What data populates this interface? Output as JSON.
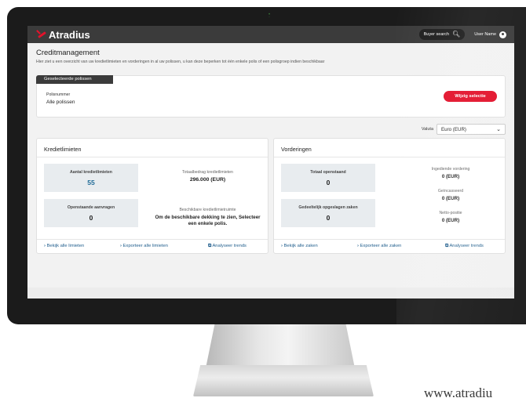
{
  "app": {
    "brand": "Atradius"
  },
  "header": {
    "buyer_search": "Buyer search",
    "user_name": "User Name"
  },
  "page": {
    "title": "Creditmanagement",
    "description": "Hier ziet u een overzicht van uw kredietlimieten en vorderingen in al uw polissen, u kan deze beperken tot één enkele polis of een polisgroep indien beschikbaar"
  },
  "selection": {
    "tab": "Geselecteerde polissen",
    "label": "Polisnummer",
    "value": "Alle polissen",
    "button": "Wijzig selectie"
  },
  "valuta": {
    "label": "Valuta",
    "selected": "Euro (EUR)"
  },
  "kredietlimieten": {
    "title": "Kredietlimieten",
    "tile1_label": "Aantal kredietlimieten",
    "tile1_value": "55",
    "tile2_label": "Openstaande aanvragen",
    "tile2_value": "0",
    "stat1_label": "Totaalbedrag kredietlimieten",
    "stat1_value": "296.000 (EUR)",
    "stat2_label": "Beschikbare kredietlimietruimte",
    "stat2_value": "Om de beschikbare dekking te zien, Selecteer een enkele polis.",
    "link1": "Bekijk alle limieten",
    "link2": "Exporteer alle limieten",
    "link3": "Analyseer trends"
  },
  "vorderingen": {
    "title": "Vorderingen",
    "tile1_label": "Totaal openstaand",
    "tile1_value": "0",
    "tile2_label": "Gedeeltelijk opgeslagen zaken",
    "tile2_value": "0",
    "stat1_label": "Ingediende vordering",
    "stat1_value": "0 (EUR)",
    "stat2_label": "Geïncasseerd",
    "stat2_value": "0 (EUR)",
    "stat3_label": "Netto-positie",
    "stat3_value": "0 (EUR)",
    "link1": "Bekijk alle zaken",
    "link2": "Exporteer alle zaken",
    "link3": "Analyseer trends"
  },
  "footer_text": "www.atradiu",
  "colors": {
    "accent": "#e3122b",
    "header": "#3b3b3b",
    "link": "#1f5d8c"
  }
}
